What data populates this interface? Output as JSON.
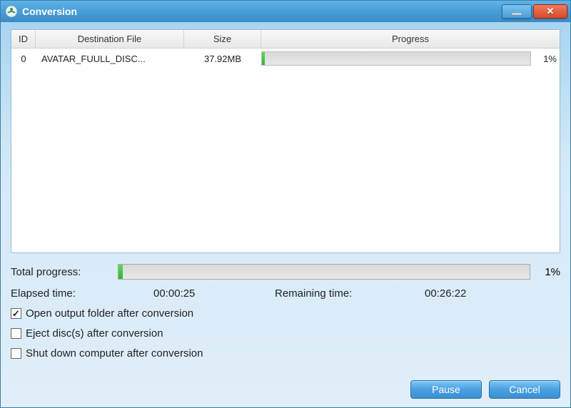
{
  "window": {
    "title": "Conversion"
  },
  "table": {
    "columns": {
      "id": "ID",
      "dest": "Destination File",
      "size": "Size",
      "progress": "Progress"
    },
    "rows": [
      {
        "id": "0",
        "dest": "AVATAR_FUULL_DISC...",
        "size": "37.92MB",
        "progress_pct": "1%",
        "progress_width": "1%"
      }
    ]
  },
  "total": {
    "label": "Total progress:",
    "pct": "1%",
    "width": "1%"
  },
  "time": {
    "elapsed_label": "Elapsed time:",
    "elapsed_value": "00:00:25",
    "remaining_label": "Remaining time:",
    "remaining_value": "00:26:22"
  },
  "options": {
    "open_folder": {
      "label": "Open output folder after conversion",
      "checked": true
    },
    "eject_disc": {
      "label": "Eject disc(s) after conversion",
      "checked": false
    },
    "shutdown": {
      "label": "Shut down computer after conversion",
      "checked": false
    }
  },
  "buttons": {
    "pause": "Pause",
    "cancel": "Cancel"
  }
}
